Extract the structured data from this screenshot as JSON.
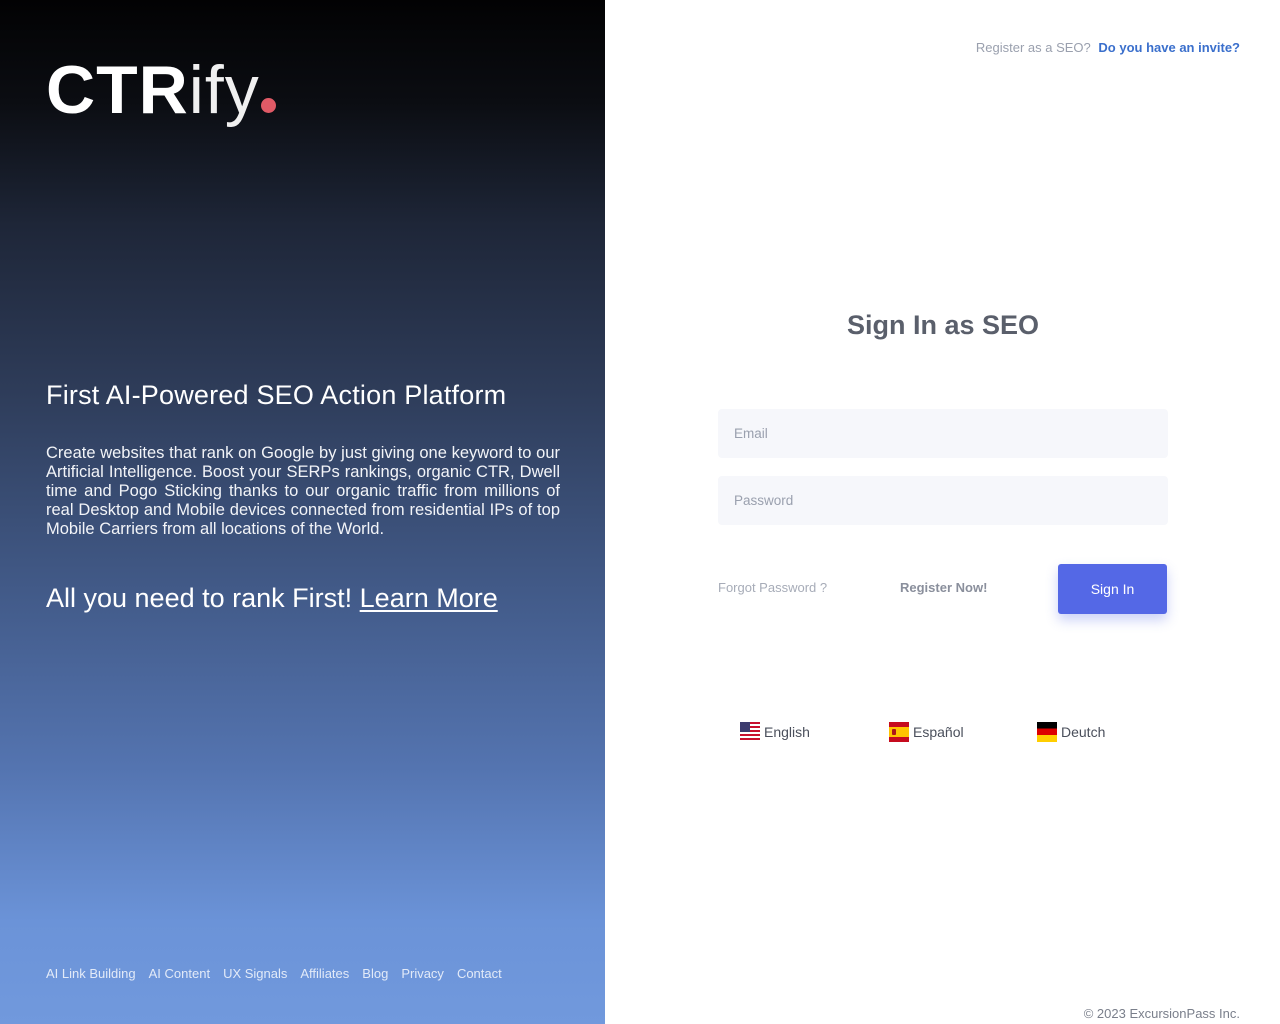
{
  "brand": {
    "logo_bold": "CTR",
    "logo_light": "ify",
    "accent_dot_color": "#e05a66"
  },
  "hero": {
    "headline": "First AI-Powered SEO Action Platform",
    "description": "Create websites that rank on Google by just giving one keyword to our Artificial Intelligence. Boost your SERPs rankings, organic CTR, Dwell time and Pogo Sticking thanks to our organic traffic from millions of real Desktop and Mobile devices connected from residential IPs of top Mobile Carriers from all locations of the World.",
    "cta_text": "All you need to rank First!",
    "cta_link": "Learn More"
  },
  "footer_links": [
    "AI Link Building",
    "AI Content",
    "UX Signals",
    "Affiliates",
    "Blog",
    "Privacy",
    "Contact"
  ],
  "top_right": {
    "register_prompt": "Register as a SEO?",
    "invite_link": "Do you have an invite?"
  },
  "signin": {
    "title": "Sign In as SEO",
    "email_placeholder": "Email",
    "password_placeholder": "Password",
    "forgot_password": "Forgot Password ?",
    "register_now": "Register Now!",
    "submit_label": "Sign In",
    "button_color": "#5468e6"
  },
  "languages": [
    {
      "label": "English",
      "icon": "us-flag-icon"
    },
    {
      "label": "Español",
      "icon": "spain-flag-icon"
    },
    {
      "label": "Deutch",
      "icon": "germany-flag-icon"
    }
  ],
  "copyright": "© 2023 ExcursionPass Inc."
}
